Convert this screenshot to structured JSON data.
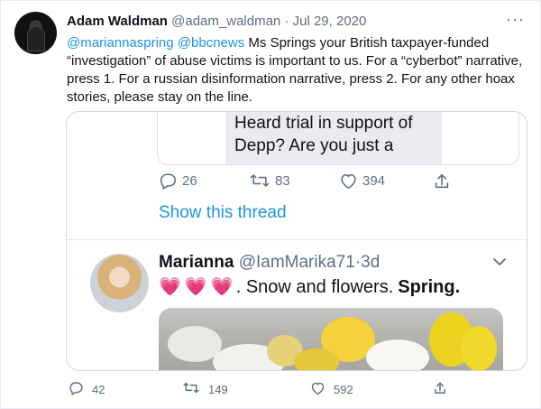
{
  "tweet": {
    "author_name": "Adam Waldman",
    "handle": "@adam_waldman",
    "separator": "·",
    "date": "Jul 29, 2020",
    "mention1": "@mariannaspring",
    "mention2": "@bbcnews",
    "text": "Ms Springs your British taxpayer-funded “investigation” of abuse victims is important to us. For a “cyberbot” narrative, press 1. For a russian disinformation narrative, press 2. For any other hoax stories, please stay on the line."
  },
  "quote": {
    "image_text_line1": "Heard trial in support of",
    "image_text_line2": "Depp? Are you just a",
    "reply_count": "26",
    "retweet_count": "83",
    "like_count": "394",
    "show_thread": "Show this thread",
    "reply": {
      "author_name": "Marianna",
      "handle": "@IamMarika71",
      "separator": "·",
      "time": "3d",
      "text_prefix": ". Snow and flowers.",
      "text_bold": "Spring."
    }
  },
  "actions": {
    "reply_count": "42",
    "retweet_count": "149",
    "like_count": "592"
  },
  "colors": {
    "link": "#1b95e0",
    "muted": "#5b7083",
    "heart": "#ff5fbf"
  }
}
